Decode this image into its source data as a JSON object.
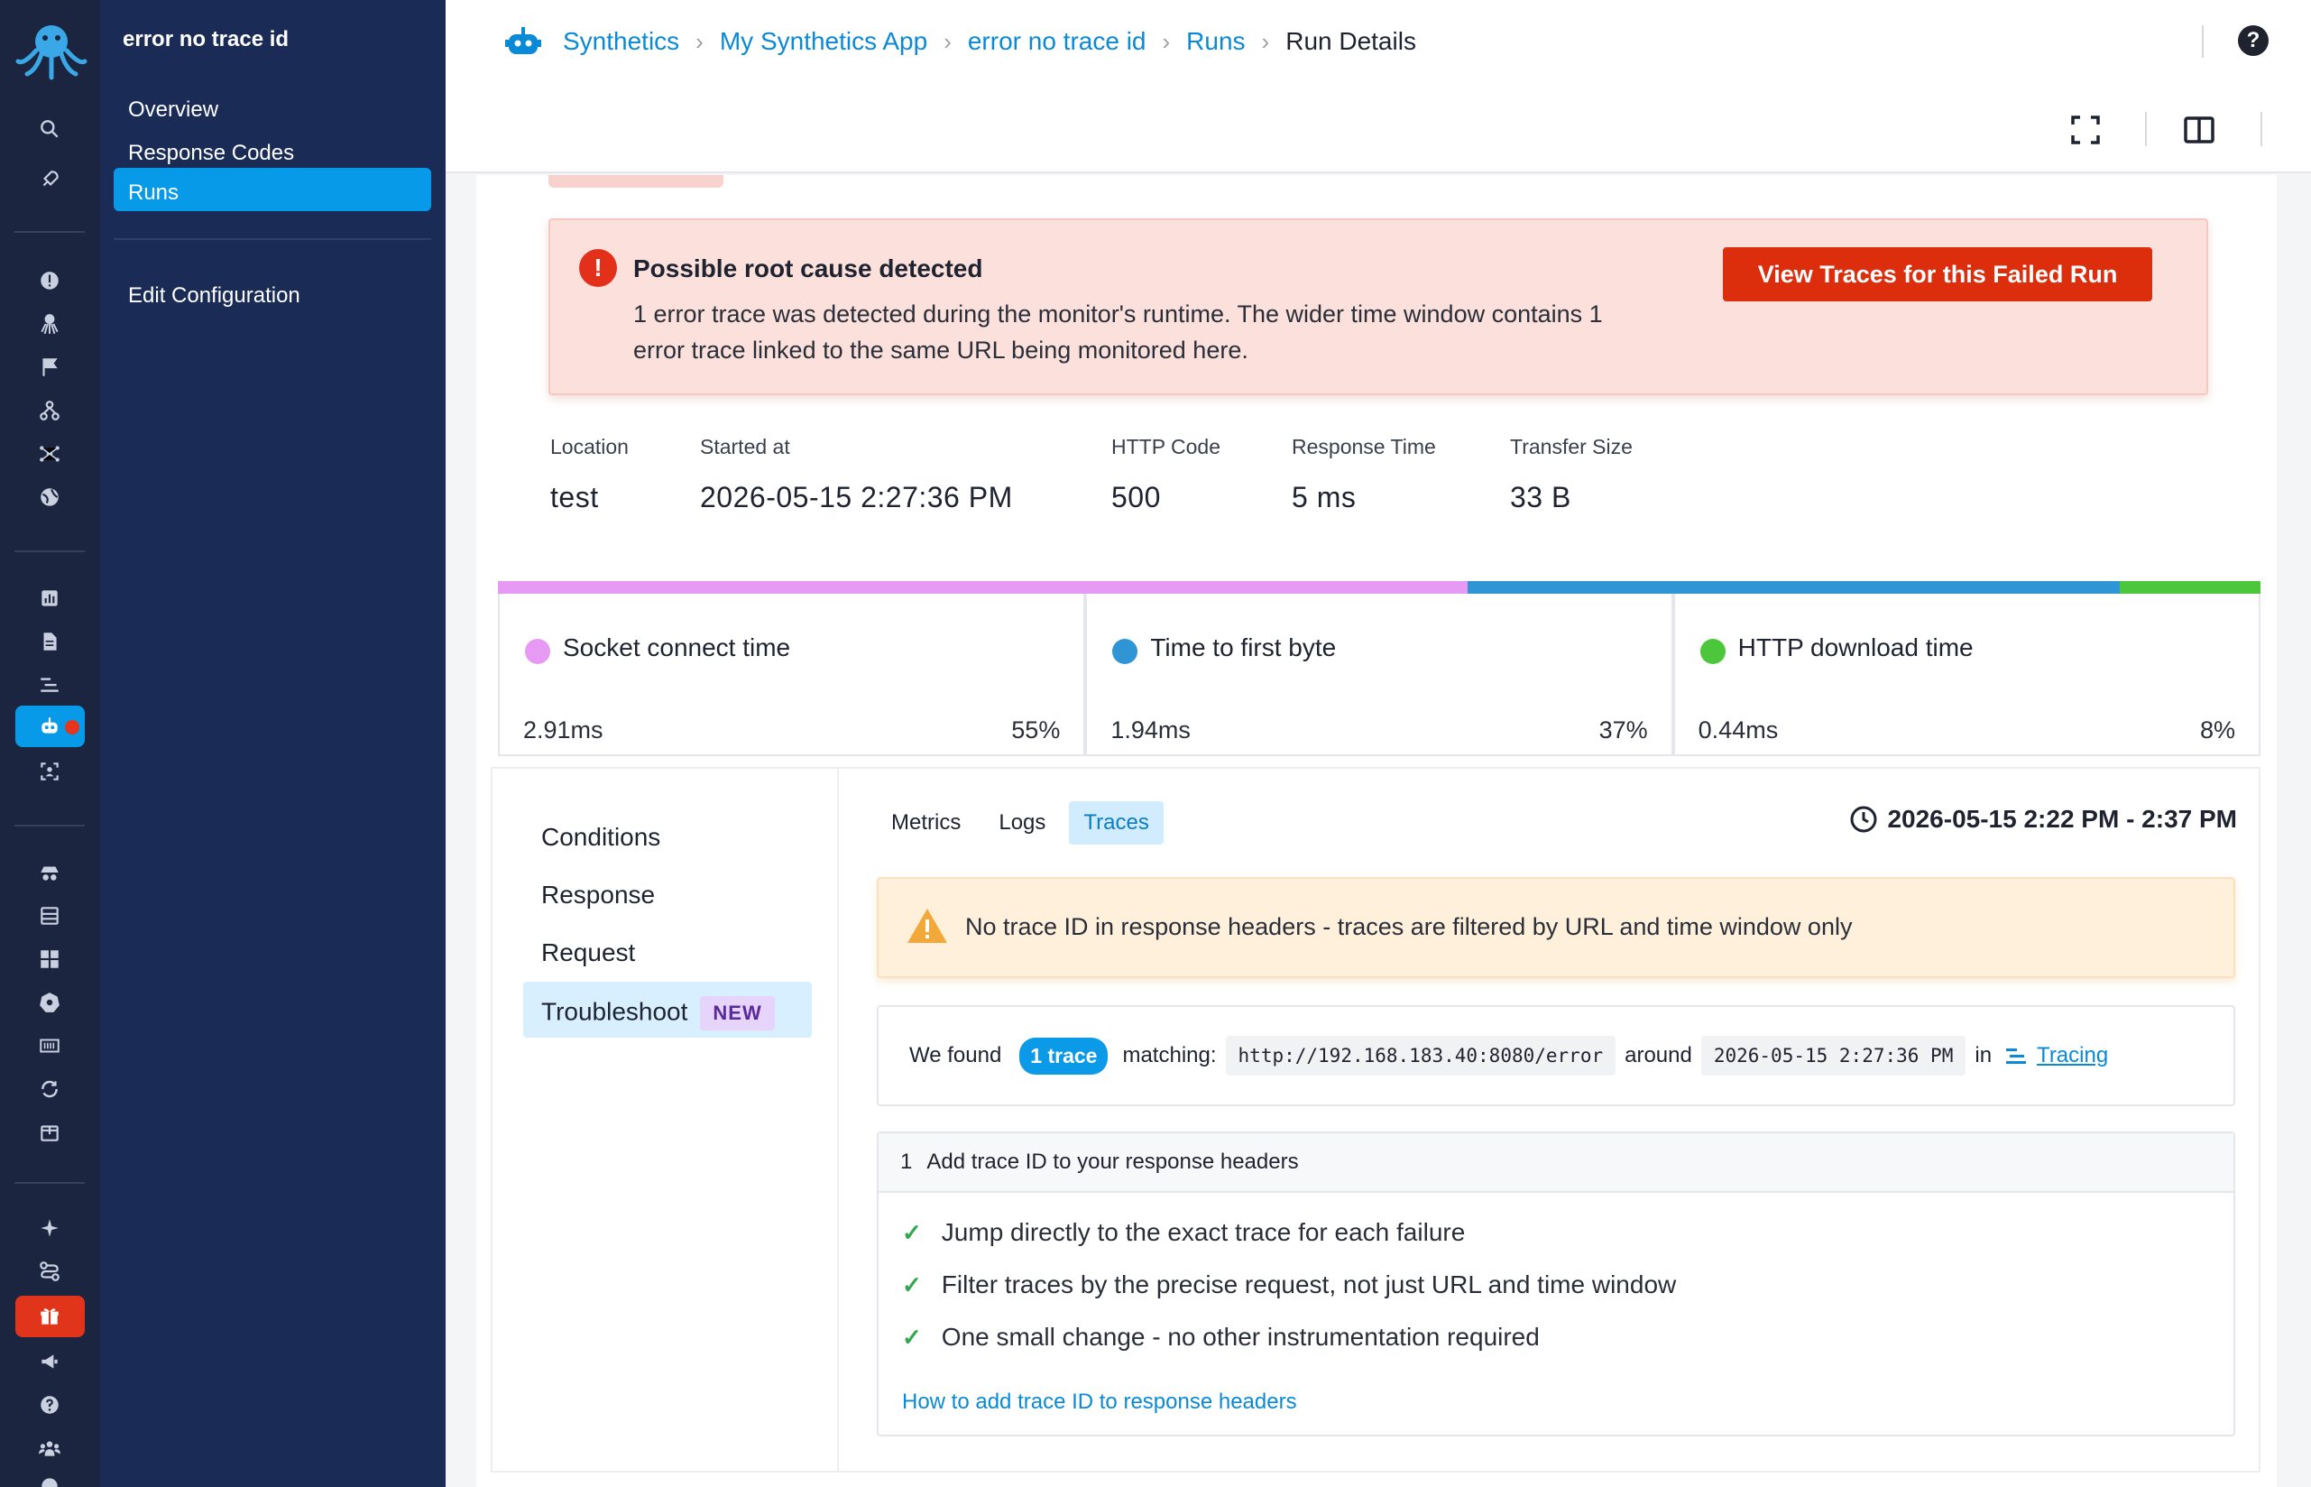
{
  "nav": {
    "title": "error no trace id",
    "items": [
      {
        "label": "Overview"
      },
      {
        "label": "Response Codes"
      },
      {
        "label": "Runs"
      },
      {
        "label": "Edit Configuration"
      }
    ]
  },
  "breadcrumb": [
    "Synthetics",
    "My Synthetics App",
    "error no trace id",
    "Runs",
    "Run Details"
  ],
  "alert": {
    "title": "Possible root cause detected",
    "body": "1 error trace was detected during the monitor's runtime. The wider time window contains 1 error trace linked to the same URL being monitored here.",
    "button": "View Traces for this Failed Run"
  },
  "stats": [
    {
      "label": "Location",
      "value": "test"
    },
    {
      "label": "Started at",
      "value": "2026-05-15 2:27:36 PM"
    },
    {
      "label": "HTTP Code",
      "value": "500"
    },
    {
      "label": "Response Time",
      "value": "5 ms"
    },
    {
      "label": "Transfer Size",
      "value": "33 B"
    }
  ],
  "timings": [
    {
      "name": "Socket connect time",
      "ms": "2.91ms",
      "pct": "55%",
      "fraction": 0.55,
      "color": "#e69af3"
    },
    {
      "name": "Time to first byte",
      "ms": "1.94ms",
      "pct": "37%",
      "fraction": 0.37,
      "color": "#2f95d5"
    },
    {
      "name": "HTTP download time",
      "ms": "0.44ms",
      "pct": "8%",
      "fraction": 0.08,
      "color": "#4cc63a"
    }
  ],
  "side_menu": [
    {
      "label": "Conditions"
    },
    {
      "label": "Response"
    },
    {
      "label": "Request"
    },
    {
      "label": "Troubleshoot",
      "badge": "NEW"
    }
  ],
  "tabs": [
    {
      "label": "Metrics"
    },
    {
      "label": "Logs"
    },
    {
      "label": "Traces"
    }
  ],
  "time_window": "2026-05-15 2:22 PM - 2:37 PM",
  "warning": "No trace ID in response headers - traces are filtered by URL and time window only",
  "found": {
    "prefix": "We found",
    "pill": "1 trace",
    "matching": "matching:",
    "url": "http://192.168.183.40:8080/error",
    "around": "around",
    "time": "2026-05-15 2:27:36 PM",
    "in": "in",
    "link": "Tracing"
  },
  "howto": {
    "step": "1",
    "title": "Add trace ID to your response headers",
    "items": [
      "Jump directly to the exact trace for each failure",
      "Filter traces by the precise request, not just URL and time window",
      "One small change - no other instrumentation required"
    ],
    "link": "How to add trace ID to response headers"
  },
  "colors": {
    "accent": "#069ae8",
    "danger": "#dc2d0c",
    "rail_bg": "#1b2540",
    "nav_bg": "#1a2b55"
  }
}
